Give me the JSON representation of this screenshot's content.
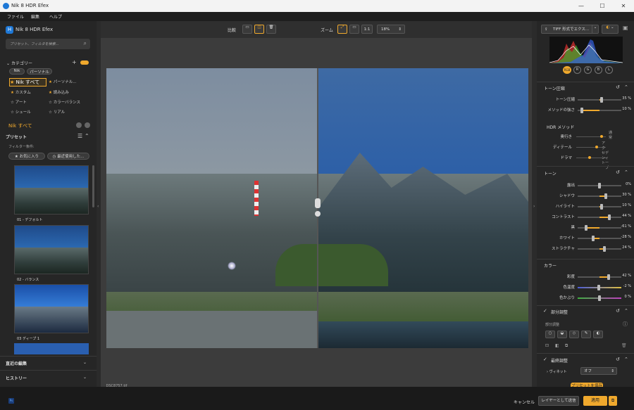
{
  "window": {
    "title": "Nik 8 HDR Efex",
    "min": "—",
    "max": "☐",
    "close": "✕"
  },
  "menu": [
    "ファイル",
    "編集",
    "ヘルプ"
  ],
  "left": {
    "app_title": "Nik 8 HDR Efex",
    "search_placeholder": "プリセット、フィルタを検索...",
    "category_label": "カテゴリー",
    "pills": [
      "Nik",
      "パーソナル"
    ],
    "categories": [
      "Nik すべて",
      "パーソナル...",
      "カスタム",
      "読み込み",
      "アート",
      "カラーバランス",
      "シュール",
      "リアル"
    ],
    "current": "Nik すべて",
    "presets_label": "プリセット",
    "filter_label": "フィルター条件:",
    "filters": [
      "お気に入り",
      "最近使用した..."
    ],
    "presets": [
      "01 - デフォルト",
      "02 - バランス",
      "03 ディープ 1"
    ],
    "recent_edits": "直近の編集",
    "history": "ヒストリー"
  },
  "toolbar": {
    "compare": "比較",
    "zoom": "ズーム",
    "one_to_one": "1:1",
    "zoom_value": "18%"
  },
  "filename": "_DSC8757.tif",
  "right": {
    "export_label": "TIFF 形式でエクス...",
    "channels": [
      "RGB",
      "R",
      "G",
      "B",
      "L"
    ],
    "tone_compression": {
      "title": "トーン圧縮",
      "rows": [
        {
          "label": "トーン圧縮",
          "value": "35 %",
          "pct": 0.55
        },
        {
          "label": "メソッドの強さ",
          "value": "10 %",
          "pct": 0.1
        }
      ]
    },
    "hdr_method": {
      "title": "HDR メソッド",
      "rows": [
        "奥行き",
        "ディテール",
        "ドラマ"
      ],
      "tags": [
        "通常",
        "アクセント",
        "ディープ"
      ]
    },
    "tone": {
      "title": "トーン",
      "rows": [
        {
          "label": "露出",
          "value": "0%",
          "pct": 0.5
        },
        {
          "label": "シャドウ",
          "value": "30 %",
          "pct": 0.65
        },
        {
          "label": "ハイライト",
          "value": "10 %",
          "pct": 0.55
        },
        {
          "label": "コントラスト",
          "value": "44 %",
          "pct": 0.72
        },
        {
          "label": "黒",
          "value": "-61 %",
          "pct": 0.2
        },
        {
          "label": "ホワイト",
          "value": "-28 %",
          "pct": 0.36
        },
        {
          "label": "ストラクチャ",
          "value": "24 %",
          "pct": 0.62
        }
      ]
    },
    "color": {
      "title": "カラー",
      "rows": [
        {
          "label": "彩度",
          "value": "42 %",
          "pct": 0.71
        },
        {
          "label": "色温度",
          "value": "-2 %",
          "pct": 0.49
        },
        {
          "label": "色かぶり",
          "value": "0 %",
          "pct": 0.5
        }
      ]
    },
    "partial": {
      "title": "部分調整",
      "sub": "部分調整"
    },
    "finish": {
      "title": "最終調整",
      "vignette": "ヴィネット",
      "vignette_value": "オフ"
    },
    "save_preset": "プリセットを保存"
  },
  "bottom": {
    "ps": "Ps",
    "cancel": "キャンセル",
    "send_layer": "レイヤーとして送信",
    "apply": "適用"
  },
  "colors": {
    "accent": "#f0a92d"
  }
}
